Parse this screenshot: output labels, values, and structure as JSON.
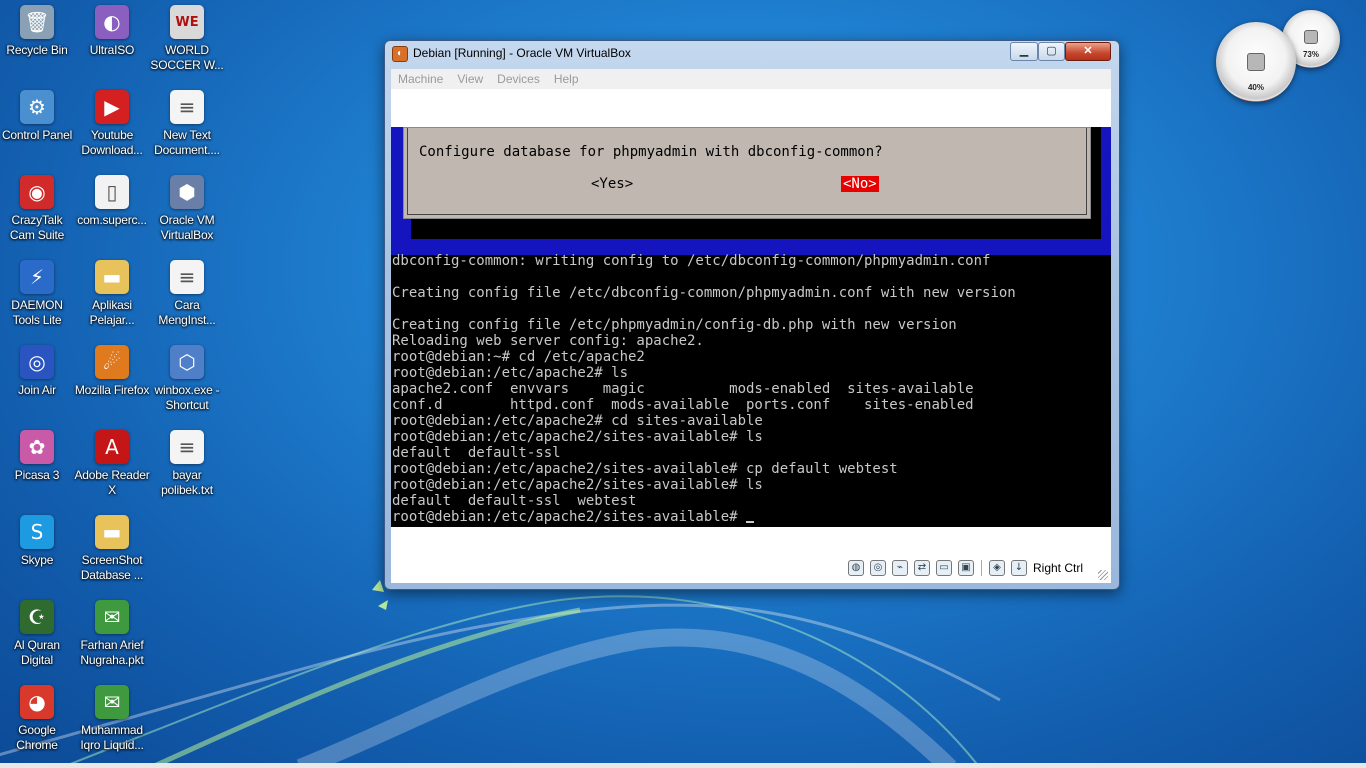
{
  "desktop_icons": [
    {
      "label": "Recycle Bin",
      "icon": "recycle-bin-icon",
      "glyph": "🗑",
      "color": "#8aa0b4"
    },
    {
      "label": "Control Panel",
      "icon": "control-panel-icon",
      "glyph": "⚙",
      "color": "#4a8fd0"
    },
    {
      "label": "CrazyTalk Cam Suite",
      "icon": "crazytalk-icon",
      "glyph": "◉",
      "color": "#d02a2a"
    },
    {
      "label": "DAEMON Tools Lite",
      "icon": "daemon-tools-icon",
      "glyph": "⚡",
      "color": "#2a6bc9"
    },
    {
      "label": "Join Air",
      "icon": "join-air-icon",
      "glyph": "◎",
      "color": "#2a55c0"
    },
    {
      "label": "Picasa 3",
      "icon": "picasa-icon",
      "glyph": "✿",
      "color": "#c85aa8"
    },
    {
      "label": "Skype",
      "icon": "skype-icon",
      "glyph": "S",
      "color": "#1e9ae0"
    },
    {
      "label": "Al Quran Digital",
      "icon": "al-quran-icon",
      "glyph": "☪",
      "color": "#2f6b2f"
    },
    {
      "label": "Google Chrome",
      "icon": "chrome-icon",
      "glyph": "◕",
      "color": "#d8392b"
    },
    {
      "label": "UltraISO",
      "icon": "ultraiso-icon",
      "glyph": "◐",
      "color": "#8b5fbf"
    },
    {
      "label": "Youtube Download...",
      "icon": "youtube-downloader-icon",
      "glyph": "▶",
      "color": "#d42020"
    },
    {
      "label": "com.superc...",
      "icon": "file-icon",
      "glyph": "▯",
      "color": "#f2f2f2"
    },
    {
      "label": "Aplikasi Pelajar...",
      "icon": "folder-icon",
      "glyph": "▬",
      "color": "#e8c25a"
    },
    {
      "label": "Mozilla Firefox",
      "icon": "firefox-icon",
      "glyph": "☄",
      "color": "#e07a1e"
    },
    {
      "label": "Adobe Reader X",
      "icon": "adobe-reader-icon",
      "glyph": "A",
      "color": "#c41616"
    },
    {
      "label": "ScreenShot Database ...",
      "icon": "folder-icon",
      "glyph": "▬",
      "color": "#e8c25a"
    },
    {
      "label": "Farhan Arief Nugraha.pkt",
      "icon": "packet-tracer-icon",
      "glyph": "✉",
      "color": "#3f9a3f"
    },
    {
      "label": "Muhammad Iqro Liquid...",
      "icon": "packet-tracer-icon",
      "glyph": "✉",
      "color": "#3f9a3f"
    },
    {
      "label": "WORLD SOCCER W...",
      "icon": "winning-eleven-icon",
      "glyph": "WE",
      "color": "#d9d9d9"
    },
    {
      "label": "New Text Document....",
      "icon": "text-document-icon",
      "glyph": "≡",
      "color": "#f4f4f4"
    },
    {
      "label": "Oracle VM VirtualBox",
      "icon": "virtualbox-icon",
      "glyph": "⬢",
      "color": "#6a7fa8"
    },
    {
      "label": "Cara MengInst...",
      "icon": "text-document-icon",
      "glyph": "≡",
      "color": "#f4f4f4"
    },
    {
      "label": "winbox.exe - Shortcut",
      "icon": "winbox-icon",
      "glyph": "⬡",
      "color": "#4f7fc9"
    },
    {
      "label": "bayar polibek.txt",
      "icon": "text-document-icon",
      "glyph": "≡",
      "color": "#f4f4f4"
    }
  ],
  "gadget": {
    "cpu_percent": "40%",
    "memory_percent": "73%"
  },
  "window": {
    "title": "Debian [Running] - Oracle VM VirtualBox",
    "controls": {
      "minimize": "▁",
      "maximize": "▢",
      "close": "✕"
    },
    "menu": [
      "Machine",
      "View",
      "Devices",
      "Help"
    ]
  },
  "dialog": {
    "question": "Configure database for phpmyadmin with dbconfig-common?",
    "yes": "<Yes>",
    "no": "<No>"
  },
  "terminal": [
    "dbconfig-common: writing config to /etc/dbconfig-common/phpmyadmin.conf",
    "",
    "Creating config file /etc/dbconfig-common/phpmyadmin.conf with new version",
    "",
    "Creating config file /etc/phpmyadmin/config-db.php with new version",
    "Reloading web server config: apache2.",
    "root@debian:~# cd /etc/apache2",
    "root@debian:/etc/apache2# ls",
    "apache2.conf  envvars    magic          mods-enabled  sites-available",
    "conf.d        httpd.conf  mods-available  ports.conf    sites-enabled",
    "root@debian:/etc/apache2# cd sites-available",
    "root@debian:/etc/apache2/sites-available# ls",
    "default  default-ssl",
    "root@debian:/etc/apache2/sites-available# cp default webtest",
    "root@debian:/etc/apache2/sites-available# ls",
    "default  default-ssl  webtest",
    "root@debian:/etc/apache2/sites-available# "
  ],
  "statusbar": {
    "hostkey": "Right Ctrl"
  }
}
